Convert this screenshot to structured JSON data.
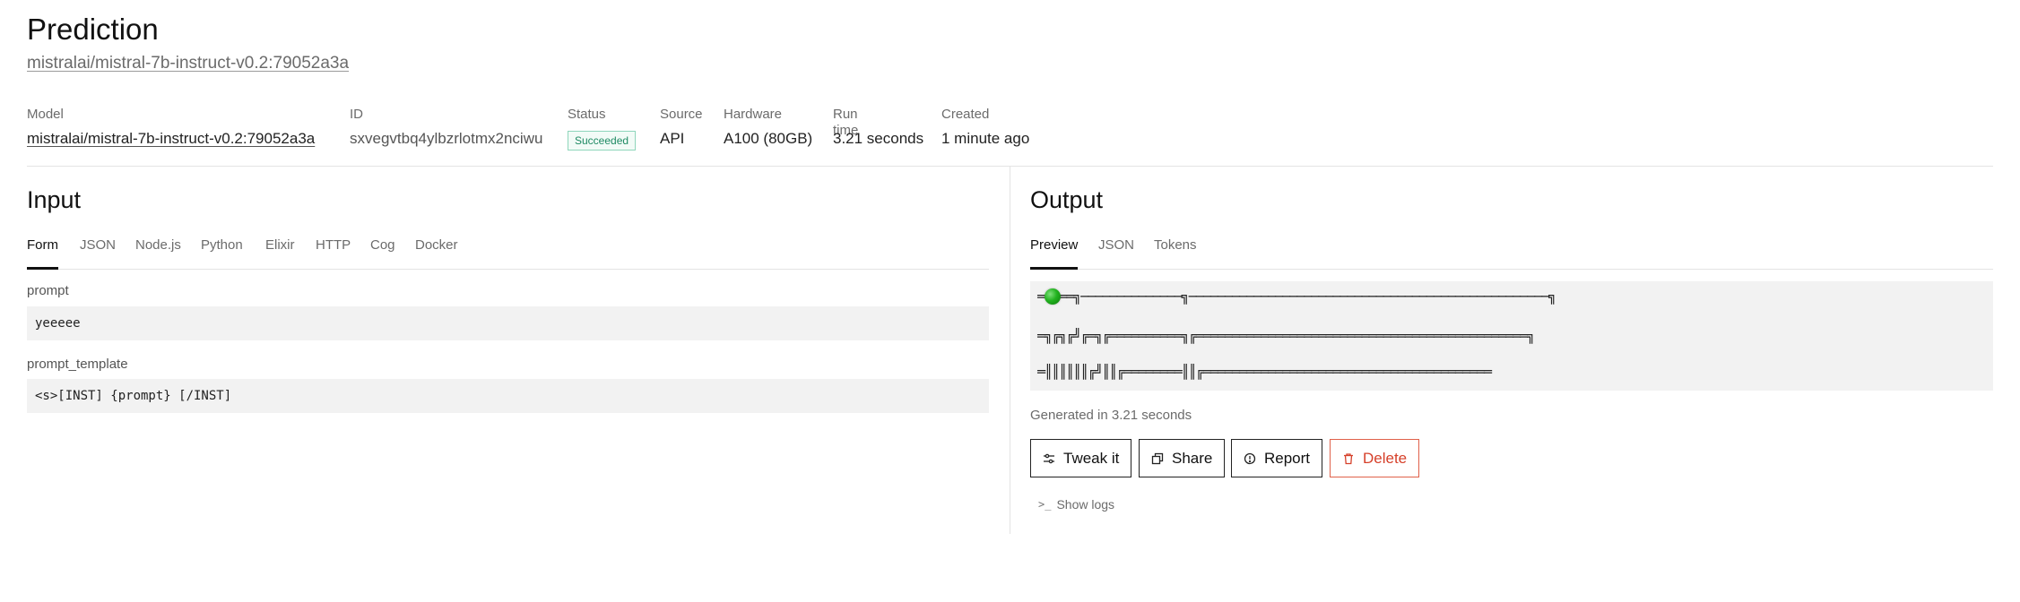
{
  "header": {
    "title": "Prediction",
    "version_link": "mistralai/mistral-7b-instruct-v0.2:79052a3a"
  },
  "meta": {
    "model": {
      "label": "Model",
      "value": "mistralai/mistral-7b-instruct-v0.2:79052a3a"
    },
    "id": {
      "label": "ID",
      "value": "sxvegvtbq4ylbzrlotmx2nciwu"
    },
    "status": {
      "label": "Status",
      "value": "Succeeded",
      "color": "#1e8a63"
    },
    "source": {
      "label": "Source",
      "value": "API"
    },
    "hardware": {
      "label": "Hardware",
      "value": "A100 (80GB)"
    },
    "run_time": {
      "label": "Run time",
      "value": "3.21 seconds"
    },
    "created": {
      "label": "Created",
      "value": "1 minute ago"
    }
  },
  "input": {
    "title": "Input",
    "tabs": [
      "Form",
      "JSON",
      "Node.js",
      "Python",
      "Elixir",
      "HTTP",
      "Cog",
      "Docker"
    ],
    "active_tab": "Form",
    "fields": [
      {
        "label": "prompt",
        "value": "yeeeee"
      },
      {
        "label": "prompt_template",
        "value": "<s>[INST] {prompt} [/INST]"
      }
    ]
  },
  "output": {
    "title": "Output",
    "tabs": [
      "Preview",
      "JSON",
      "Tokens"
    ],
    "active_tab": "Preview",
    "preview_lines": [
      "═  ══╗──────────────╗──────────────────────────────────────────────────╗",
      "═╗╔╗╔╝╔═╗╔══════════╗╔══════════════════════════════════════════════╗",
      "═║║║║║║╔╝║║╔════════║║╔════════════════════════════════════════"
    ],
    "generated_text": "Generated in 3.21 seconds",
    "buttons": {
      "tweak": "Tweak it",
      "share": "Share",
      "report": "Report",
      "delete": "Delete"
    },
    "show_logs": "Show logs",
    "accent_danger": "#d6402a"
  }
}
